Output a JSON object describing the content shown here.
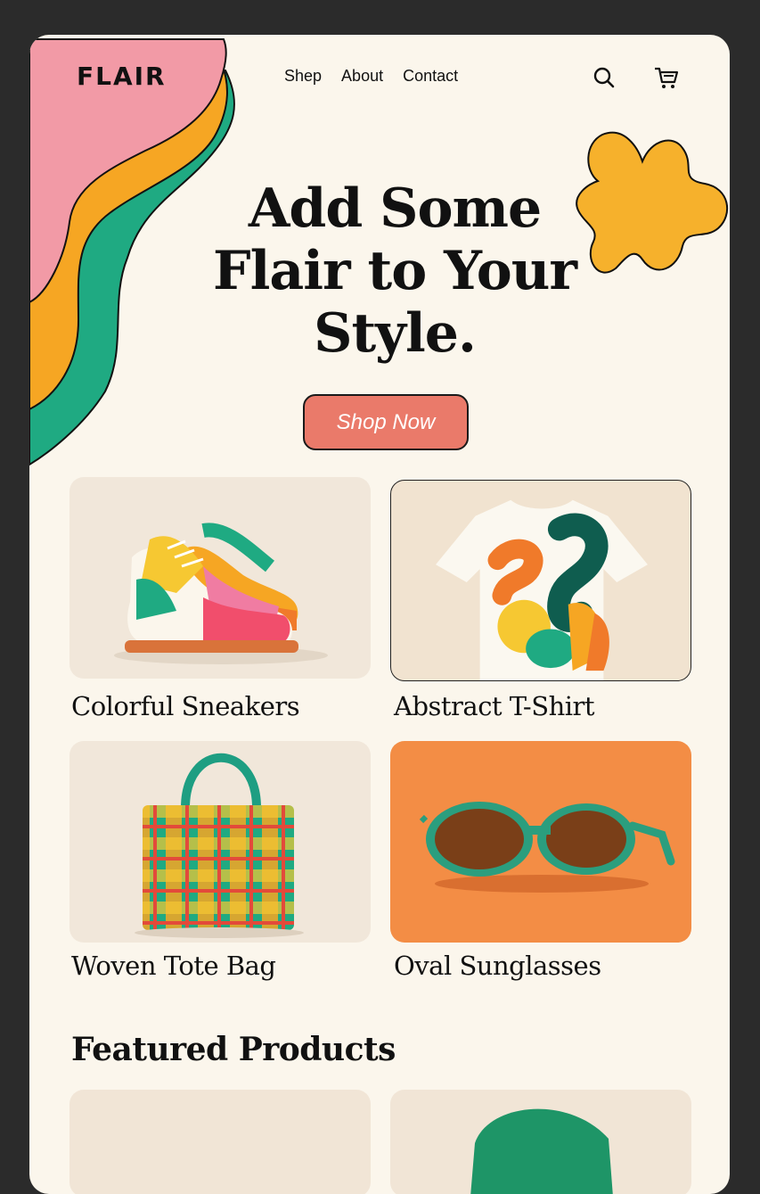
{
  "brand": {
    "logo": "FLAIR"
  },
  "nav": {
    "items": [
      "Shep",
      "About",
      "Contact"
    ]
  },
  "header_icons": [
    "search-icon",
    "cart-icon"
  ],
  "hero": {
    "title": "Add Some Flair to Your Style.",
    "cta_label": "Shop Now"
  },
  "products": [
    {
      "name": "Colorful Sneakers"
    },
    {
      "name": "Abstract T-Shirt"
    },
    {
      "name": "Woven Tote Bag"
    },
    {
      "name": "Oval Sunglasses"
    }
  ],
  "featured": {
    "title": "Featured Products"
  },
  "colors": {
    "background": "#fbf6ec",
    "pink": "#f29aa6",
    "orange": "#f6a623",
    "green": "#1faa82",
    "coral_button": "#ea7a6a",
    "sunglasses_bg": "#f38d45"
  }
}
